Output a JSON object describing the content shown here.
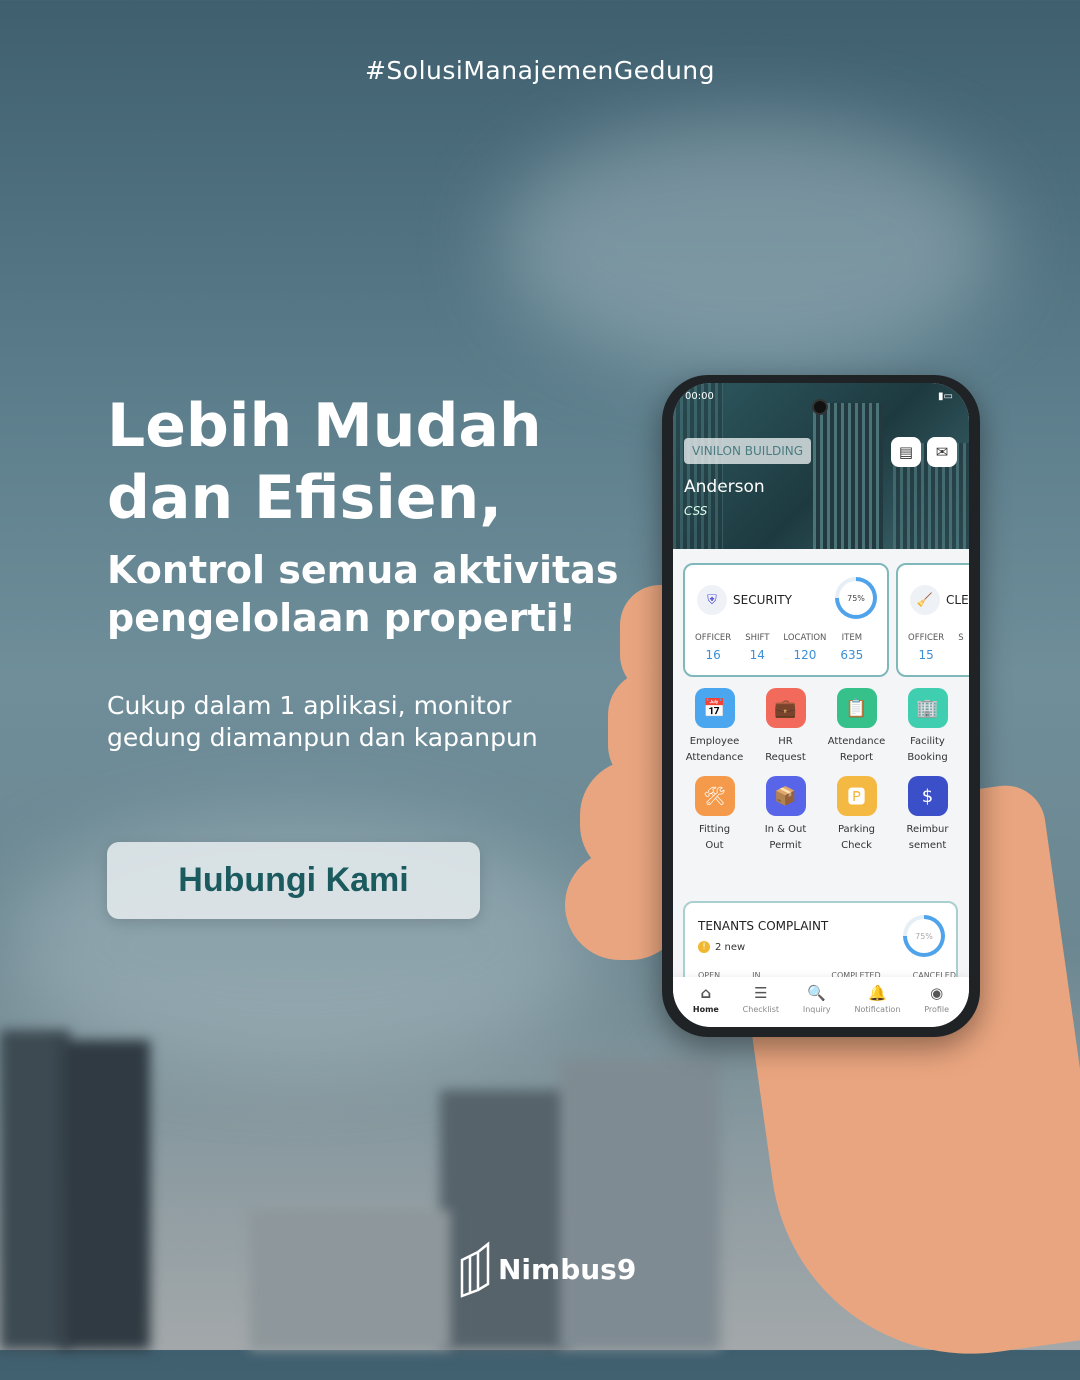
{
  "hashtag": "#SolusiManajemenGedung",
  "headline": {
    "line1": "Lebih Mudah",
    "line2": "dan Efisien,",
    "sub1": "Kontrol semua aktivitas",
    "sub2": "pengelolaan properti!"
  },
  "description": {
    "line1": "Cukup dalam 1 aplikasi, monitor",
    "line2": "gedung diamanpun dan kapanpun"
  },
  "cta_label": "Hubungi Kami",
  "brand": "Nimbus9",
  "app": {
    "status_time": "00:00",
    "building": "VINILON BUILDING",
    "user_name": "Anderson",
    "user_role": "CSS",
    "cards": [
      {
        "title": "SECURITY",
        "icon": "shield-icon",
        "progress": "75%",
        "stats": [
          {
            "label": "OFFICER",
            "value": "16"
          },
          {
            "label": "SHIFT",
            "value": "14"
          },
          {
            "label": "LOCATION",
            "value": "120"
          },
          {
            "label": "ITEM",
            "value": "635"
          }
        ]
      },
      {
        "title": "CLE",
        "icon": "broom-icon",
        "stats": [
          {
            "label": "OFFICER",
            "value": "15"
          },
          {
            "label": "S",
            "value": ""
          }
        ]
      }
    ],
    "apps": [
      {
        "l1": "Employee",
        "l2": "Attendance",
        "color": "#4aa6ef",
        "icon": "calendar-user-icon",
        "glyph": "📅"
      },
      {
        "l1": "HR",
        "l2": "Request",
        "color": "#f26a5b",
        "icon": "briefcase-icon",
        "glyph": "💼"
      },
      {
        "l1": "Attendance",
        "l2": "Report",
        "color": "#36c08a",
        "icon": "report-icon",
        "glyph": "📋"
      },
      {
        "l1": "Facility",
        "l2": "Booking",
        "color": "#3fcfb0",
        "icon": "building-icon",
        "glyph": "🏢"
      },
      {
        "l1": "Fitting",
        "l2": "Out",
        "color": "#f59a4a",
        "icon": "tools-icon",
        "glyph": "🛠"
      },
      {
        "l1": "In & Out",
        "l2": "Permit",
        "color": "#5865e8",
        "icon": "trolley-icon",
        "glyph": "📦"
      },
      {
        "l1": "Parking",
        "l2": "Check",
        "color": "#f4b942",
        "icon": "parking-icon",
        "glyph": "🅿"
      },
      {
        "l1": "Reimbur",
        "l2": "sement",
        "color": "#3b4fc8",
        "icon": "receipt-icon",
        "glyph": "$"
      }
    ],
    "complaint": {
      "title": "TENANTS COMPLAINT",
      "new": "2 new",
      "progress": "75%",
      "columns": [
        "OPEN",
        "IN PROGRESS",
        "COMPLETED",
        "CANCELED"
      ]
    },
    "nav": [
      {
        "label": "Home",
        "glyph": "⌂"
      },
      {
        "label": "Checklist",
        "glyph": "☰"
      },
      {
        "label": "Inquiry",
        "glyph": "🔍"
      },
      {
        "label": "Notification",
        "glyph": "🔔"
      },
      {
        "label": "Profile",
        "glyph": "◉"
      }
    ]
  }
}
